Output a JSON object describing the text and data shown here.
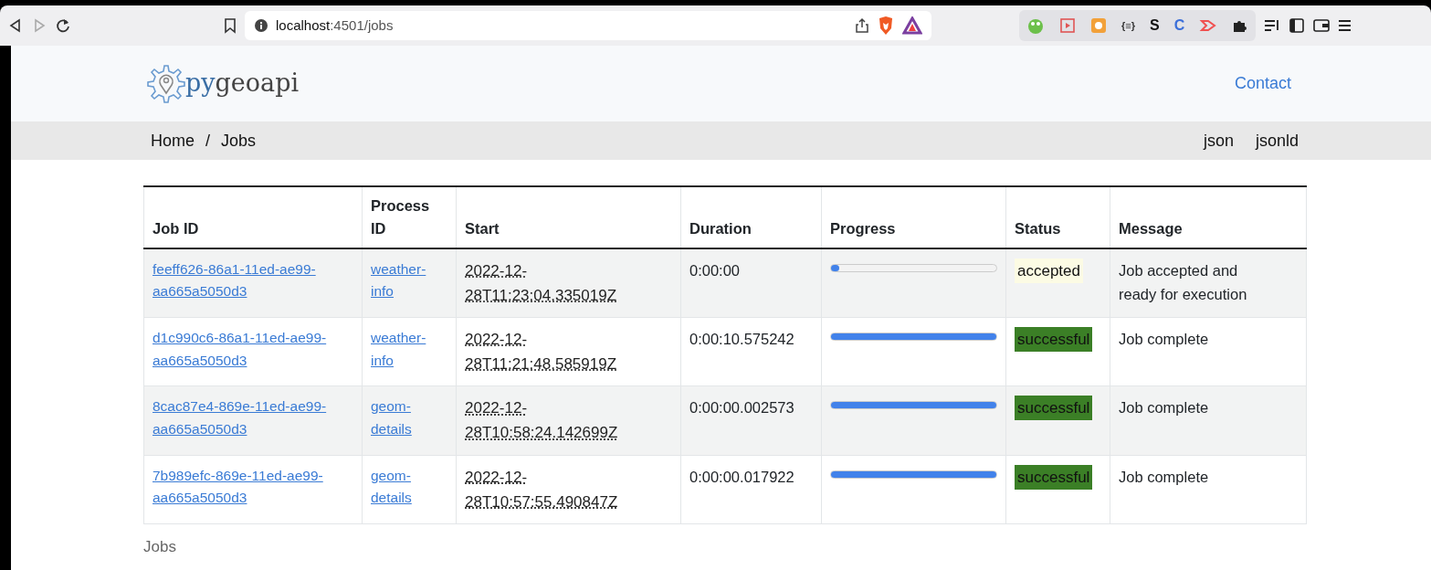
{
  "browser": {
    "url_host": "localhost",
    "url_path": ":4501/jobs",
    "forward_disabled": true,
    "extensions": [
      {
        "kind": "text",
        "label": "{≡}",
        "color": "#333333"
      },
      {
        "kind": "text",
        "label": "S",
        "color": "#111111"
      },
      {
        "kind": "text",
        "label": "C",
        "color": "#3b6fd9"
      }
    ]
  },
  "header": {
    "logo_prefix": "py",
    "logo_suffix": "geoapi",
    "contact": "Contact"
  },
  "breadcrumb": {
    "items": [
      "Home",
      "Jobs"
    ],
    "separator": "/",
    "formats": [
      "json",
      "jsonld"
    ]
  },
  "table": {
    "columns": [
      "Job ID",
      "Process ID",
      "Start",
      "Duration",
      "Progress",
      "Status",
      "Message"
    ],
    "rows": [
      {
        "job_id": "feeff626-86a1-11ed-ae99-aa665a5050d3",
        "process_id": "weather-info",
        "start": "2022-12-28T11:23:04.335019Z",
        "duration": "0:00:00",
        "level": 0.05,
        "status": "accepted",
        "kind": "accepted",
        "message": "Job accepted and ready for execution"
      },
      {
        "job_id": "d1c990c6-86a1-11ed-ae99-aa665a5050d3",
        "process_id": "weather-info",
        "start": "2022-12-28T11:21:48.585919Z",
        "duration": "0:00:10.575242",
        "level": 1,
        "status": "successful",
        "kind": "successful",
        "message": "Job complete"
      },
      {
        "job_id": "8cac87e4-869e-11ed-ae99-aa665a5050d3",
        "process_id": "geom-details",
        "start": "2022-12-28T10:58:24.142699Z",
        "duration": "0:00:00.002573",
        "level": 1,
        "status": "successful",
        "kind": "successful",
        "message": "Job complete"
      },
      {
        "job_id": "7b989efc-869e-11ed-ae99-aa665a5050d3",
        "process_id": "geom-details",
        "start": "2022-12-28T10:57:55.490847Z",
        "duration": "0:00:00.017922",
        "level": 1,
        "status": "successful",
        "kind": "successful",
        "message": "Job complete"
      }
    ],
    "caption": "Jobs"
  }
}
